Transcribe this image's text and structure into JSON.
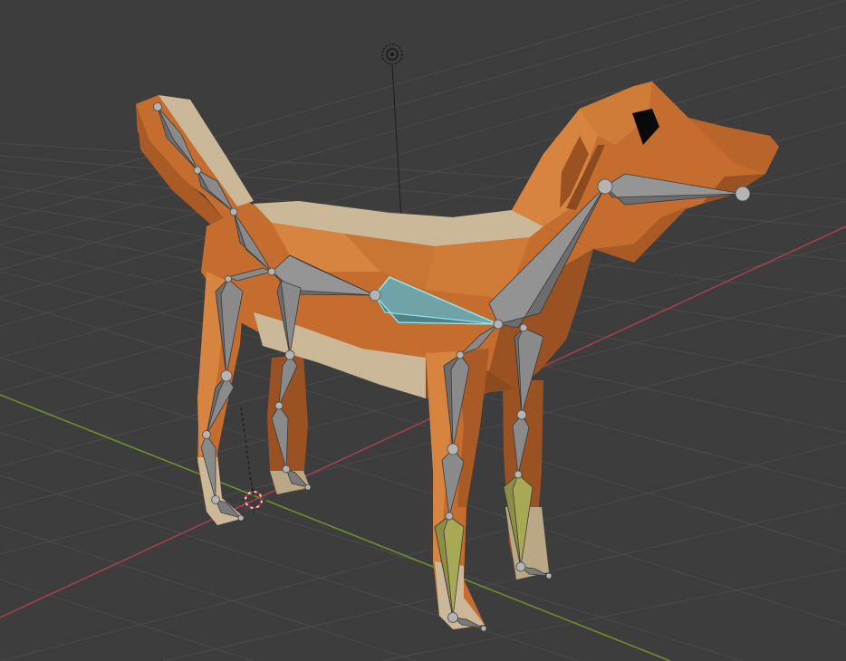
{
  "viewport": {
    "mode": "pose",
    "background": "#3d3d3d",
    "grid_color": "#4c4c4c",
    "axis_x_color": "#a3404d",
    "axis_y_color": "#6c8f2b"
  },
  "model": {
    "name": "dog",
    "body_color": "#c46d2f",
    "body_shadow_color": "#9a5222",
    "body_highlight_color": "#d78441",
    "belly_color": "#cbb898",
    "eye_color": "#0a0a0a"
  },
  "armature": {
    "bone_color": "#8a8a8a",
    "bone_dark_color": "#6a6a6a",
    "joint_color": "#b4b4b4",
    "selected_bone_color": "#6fa3a8",
    "selected_outline_color": "#8fe3ea",
    "ik_bone_color": "#a7a955",
    "bones": [
      "tail-bone-1",
      "tail-bone-2",
      "spine-bone-1",
      "spine-bone-2",
      "chest-bone-selected",
      "neck-bone",
      "head-bone",
      "front-left-upper-leg",
      "front-left-lower-leg",
      "front-left-ik-foot",
      "front-right-upper-leg",
      "front-right-lower-leg",
      "front-right-ik-foot",
      "hind-left-upper-leg",
      "hind-left-lower-leg",
      "hind-left-foot",
      "hind-right-upper-leg",
      "hind-right-lower-leg",
      "hind-right-foot"
    ]
  },
  "scene_objects": {
    "light_icon": "light-icon",
    "cursor_icon": "3d-cursor-icon"
  }
}
